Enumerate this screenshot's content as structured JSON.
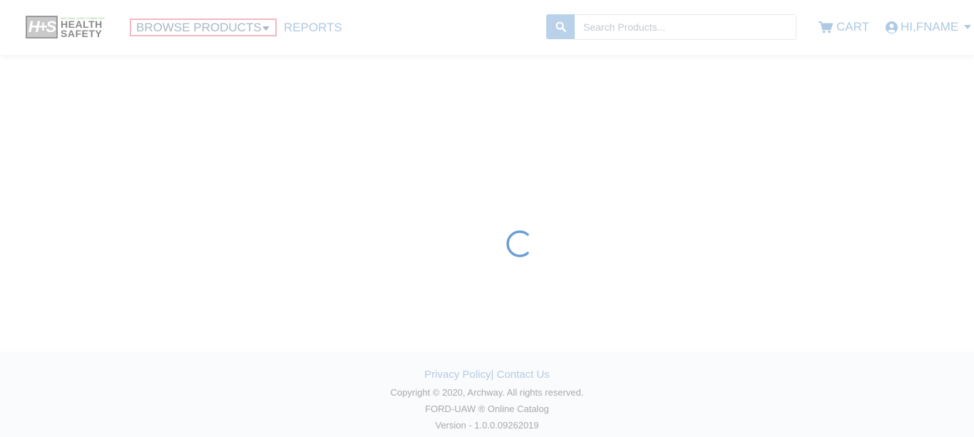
{
  "header": {
    "logo": {
      "mark": "H+S",
      "tagline": "NATIONAL JOINT COMMITTEE",
      "line1": "HEALTH",
      "line2": "SAFETY"
    },
    "nav": {
      "browse_label": "BROWSE PRODUCTS",
      "reports_label": "REPORTS"
    },
    "search": {
      "placeholder": "Search Products..."
    },
    "cart_label": "CART",
    "user_label": "HI,FNAME"
  },
  "footer": {
    "privacy_label": "Privacy Policy",
    "separator": "|",
    "contact_label": "Contact Us",
    "copyright": "Copyright © 2020, Archway. All rights reserved.",
    "catalog": "FORD-UAW ® Online Catalog",
    "version": "Version - 1.0.0.09262019"
  },
  "colors": {
    "accent": "#aec9e3",
    "search_button": "#b9d2ea",
    "spinner": "#5b93cf",
    "focus_border": "#f2b8c4",
    "progress": "#6fb3e8"
  },
  "icons": [
    "search-icon",
    "cart-icon",
    "user-circle-icon",
    "chevron-down-icon",
    "loading-spinner-icon"
  ]
}
